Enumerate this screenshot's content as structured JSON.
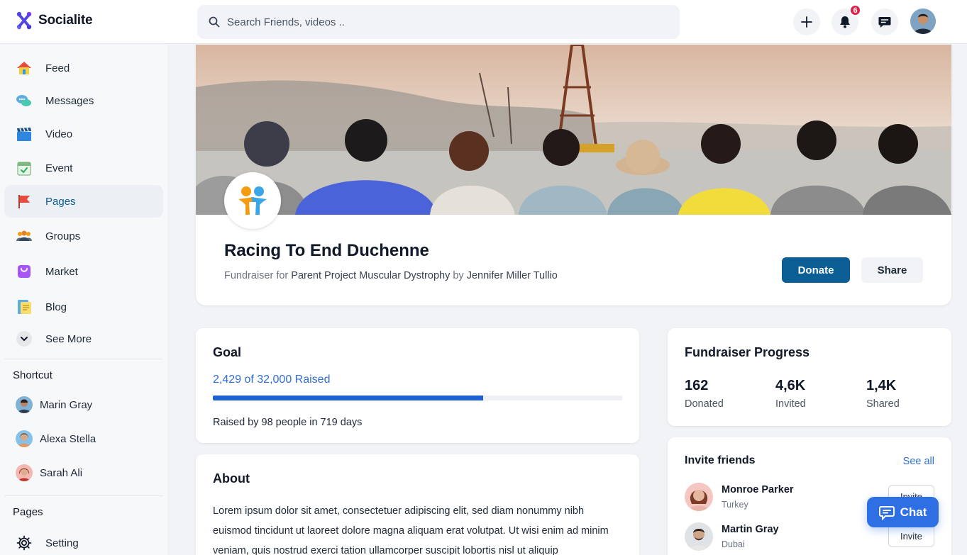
{
  "app": {
    "name": "Socialite"
  },
  "search": {
    "placeholder": "Search Friends, videos .."
  },
  "header": {
    "notification_count": "6"
  },
  "sidebar": {
    "items": [
      {
        "label": "Feed",
        "icon": "home-icon"
      },
      {
        "label": "Messages",
        "icon": "chat-bubbles-icon"
      },
      {
        "label": "Video",
        "icon": "clapperboard-icon"
      },
      {
        "label": "Event",
        "icon": "calendar-icon"
      },
      {
        "label": "Pages",
        "icon": "flag-icon",
        "active": true
      },
      {
        "label": "Groups",
        "icon": "group-icon"
      },
      {
        "label": "Market",
        "icon": "shopping-bag-icon"
      },
      {
        "label": "Blog",
        "icon": "blog-icon"
      },
      {
        "label": "See More",
        "icon": "chevron-down-icon"
      }
    ],
    "shortcut_heading": "Shortcut",
    "shortcuts": [
      {
        "name": "Marin Gray"
      },
      {
        "name": "Alexa Stella"
      },
      {
        "name": "Sarah Ali"
      }
    ],
    "pages_heading": "Pages",
    "pages_items": [
      {
        "label": "Setting",
        "icon": "gear-icon"
      }
    ]
  },
  "fundraiser": {
    "title": "Racing To End Duchenne",
    "sub_prefix": "Fundraiser for",
    "org": "Parent Project Muscular Dystrophy",
    "by": "by",
    "author": "Jennifer Miller Tullio",
    "donate_label": "Donate",
    "share_label": "Share"
  },
  "goal": {
    "heading": "Goal",
    "raised_text": "2,429 of 32,000 Raised",
    "progress": 0.66,
    "note": "Raised by 98 people in 719 days"
  },
  "about": {
    "heading": "About",
    "text": "Lorem ipsum dolor sit amet, consectetuer adipiscing elit, sed diam nonummy nibh euismod tincidunt ut laoreet dolore magna aliquam erat volutpat. Ut wisi enim ad minim veniam, quis nostrud exerci tation ullamcorper suscipit lobortis nisl ut aliquip"
  },
  "progress": {
    "heading": "Fundraiser Progress",
    "stats": [
      {
        "value": "162",
        "label": "Donated"
      },
      {
        "value": "4,6K",
        "label": "Invited"
      },
      {
        "value": "1,4K",
        "label": "Shared"
      }
    ]
  },
  "invite": {
    "heading": "Invite friends",
    "see_all": "See all",
    "friends": [
      {
        "name": "Monroe Parker",
        "location": "Turkey",
        "button": "Invite"
      },
      {
        "name": "Martin Gray",
        "location": "Dubai",
        "button": "Invite"
      }
    ]
  },
  "chat": {
    "label": "Chat"
  },
  "colors": {
    "primary": "#0b5f94",
    "accent_blue": "#2f6fd6",
    "badge": "#e11d48"
  }
}
